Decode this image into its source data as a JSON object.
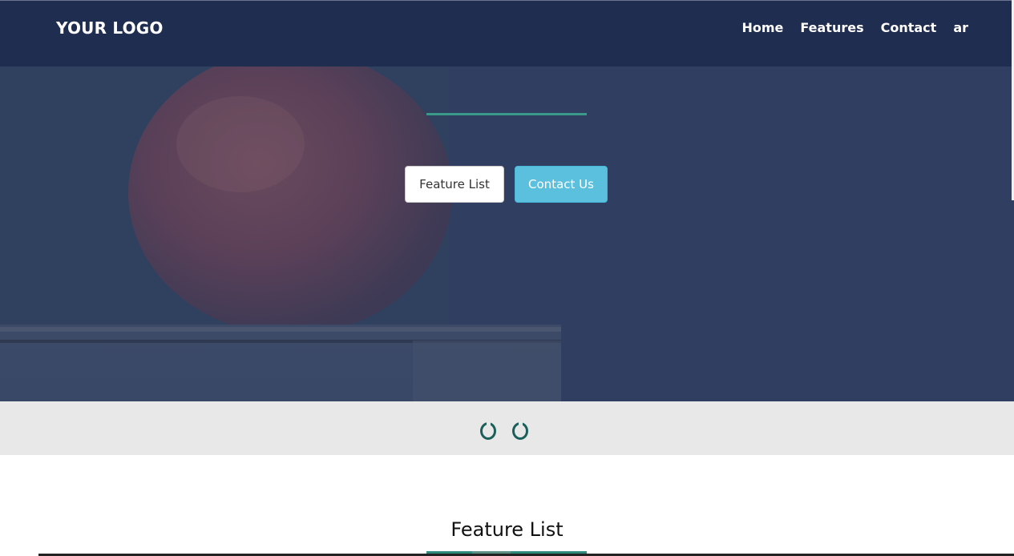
{
  "header": {
    "logo": "YOUR LOGO",
    "nav": [
      "Home",
      "Features",
      "Contact",
      "ar"
    ]
  },
  "hero": {
    "buttons": {
      "feature_list": "Feature List",
      "contact_us": "Contact Us"
    }
  },
  "slider": {
    "indicator_count": 2
  },
  "features_section": {
    "title": "Feature List"
  },
  "colors": {
    "header_bg": "#1f2d50",
    "accent": "#3a9a8a",
    "contact_button": "#5bc0de",
    "indicator": "#1b5f5a"
  }
}
